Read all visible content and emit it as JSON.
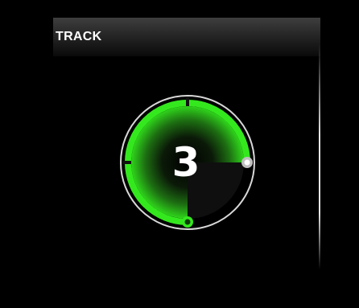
{
  "header": {
    "title": "TRACK"
  },
  "dial": {
    "value": "3",
    "level": 0.75,
    "accent_color": "#34e81e",
    "ring_color": "#d8d8d8",
    "start_handle_color": "#34e81e",
    "end_handle_color": "#ffffff"
  }
}
